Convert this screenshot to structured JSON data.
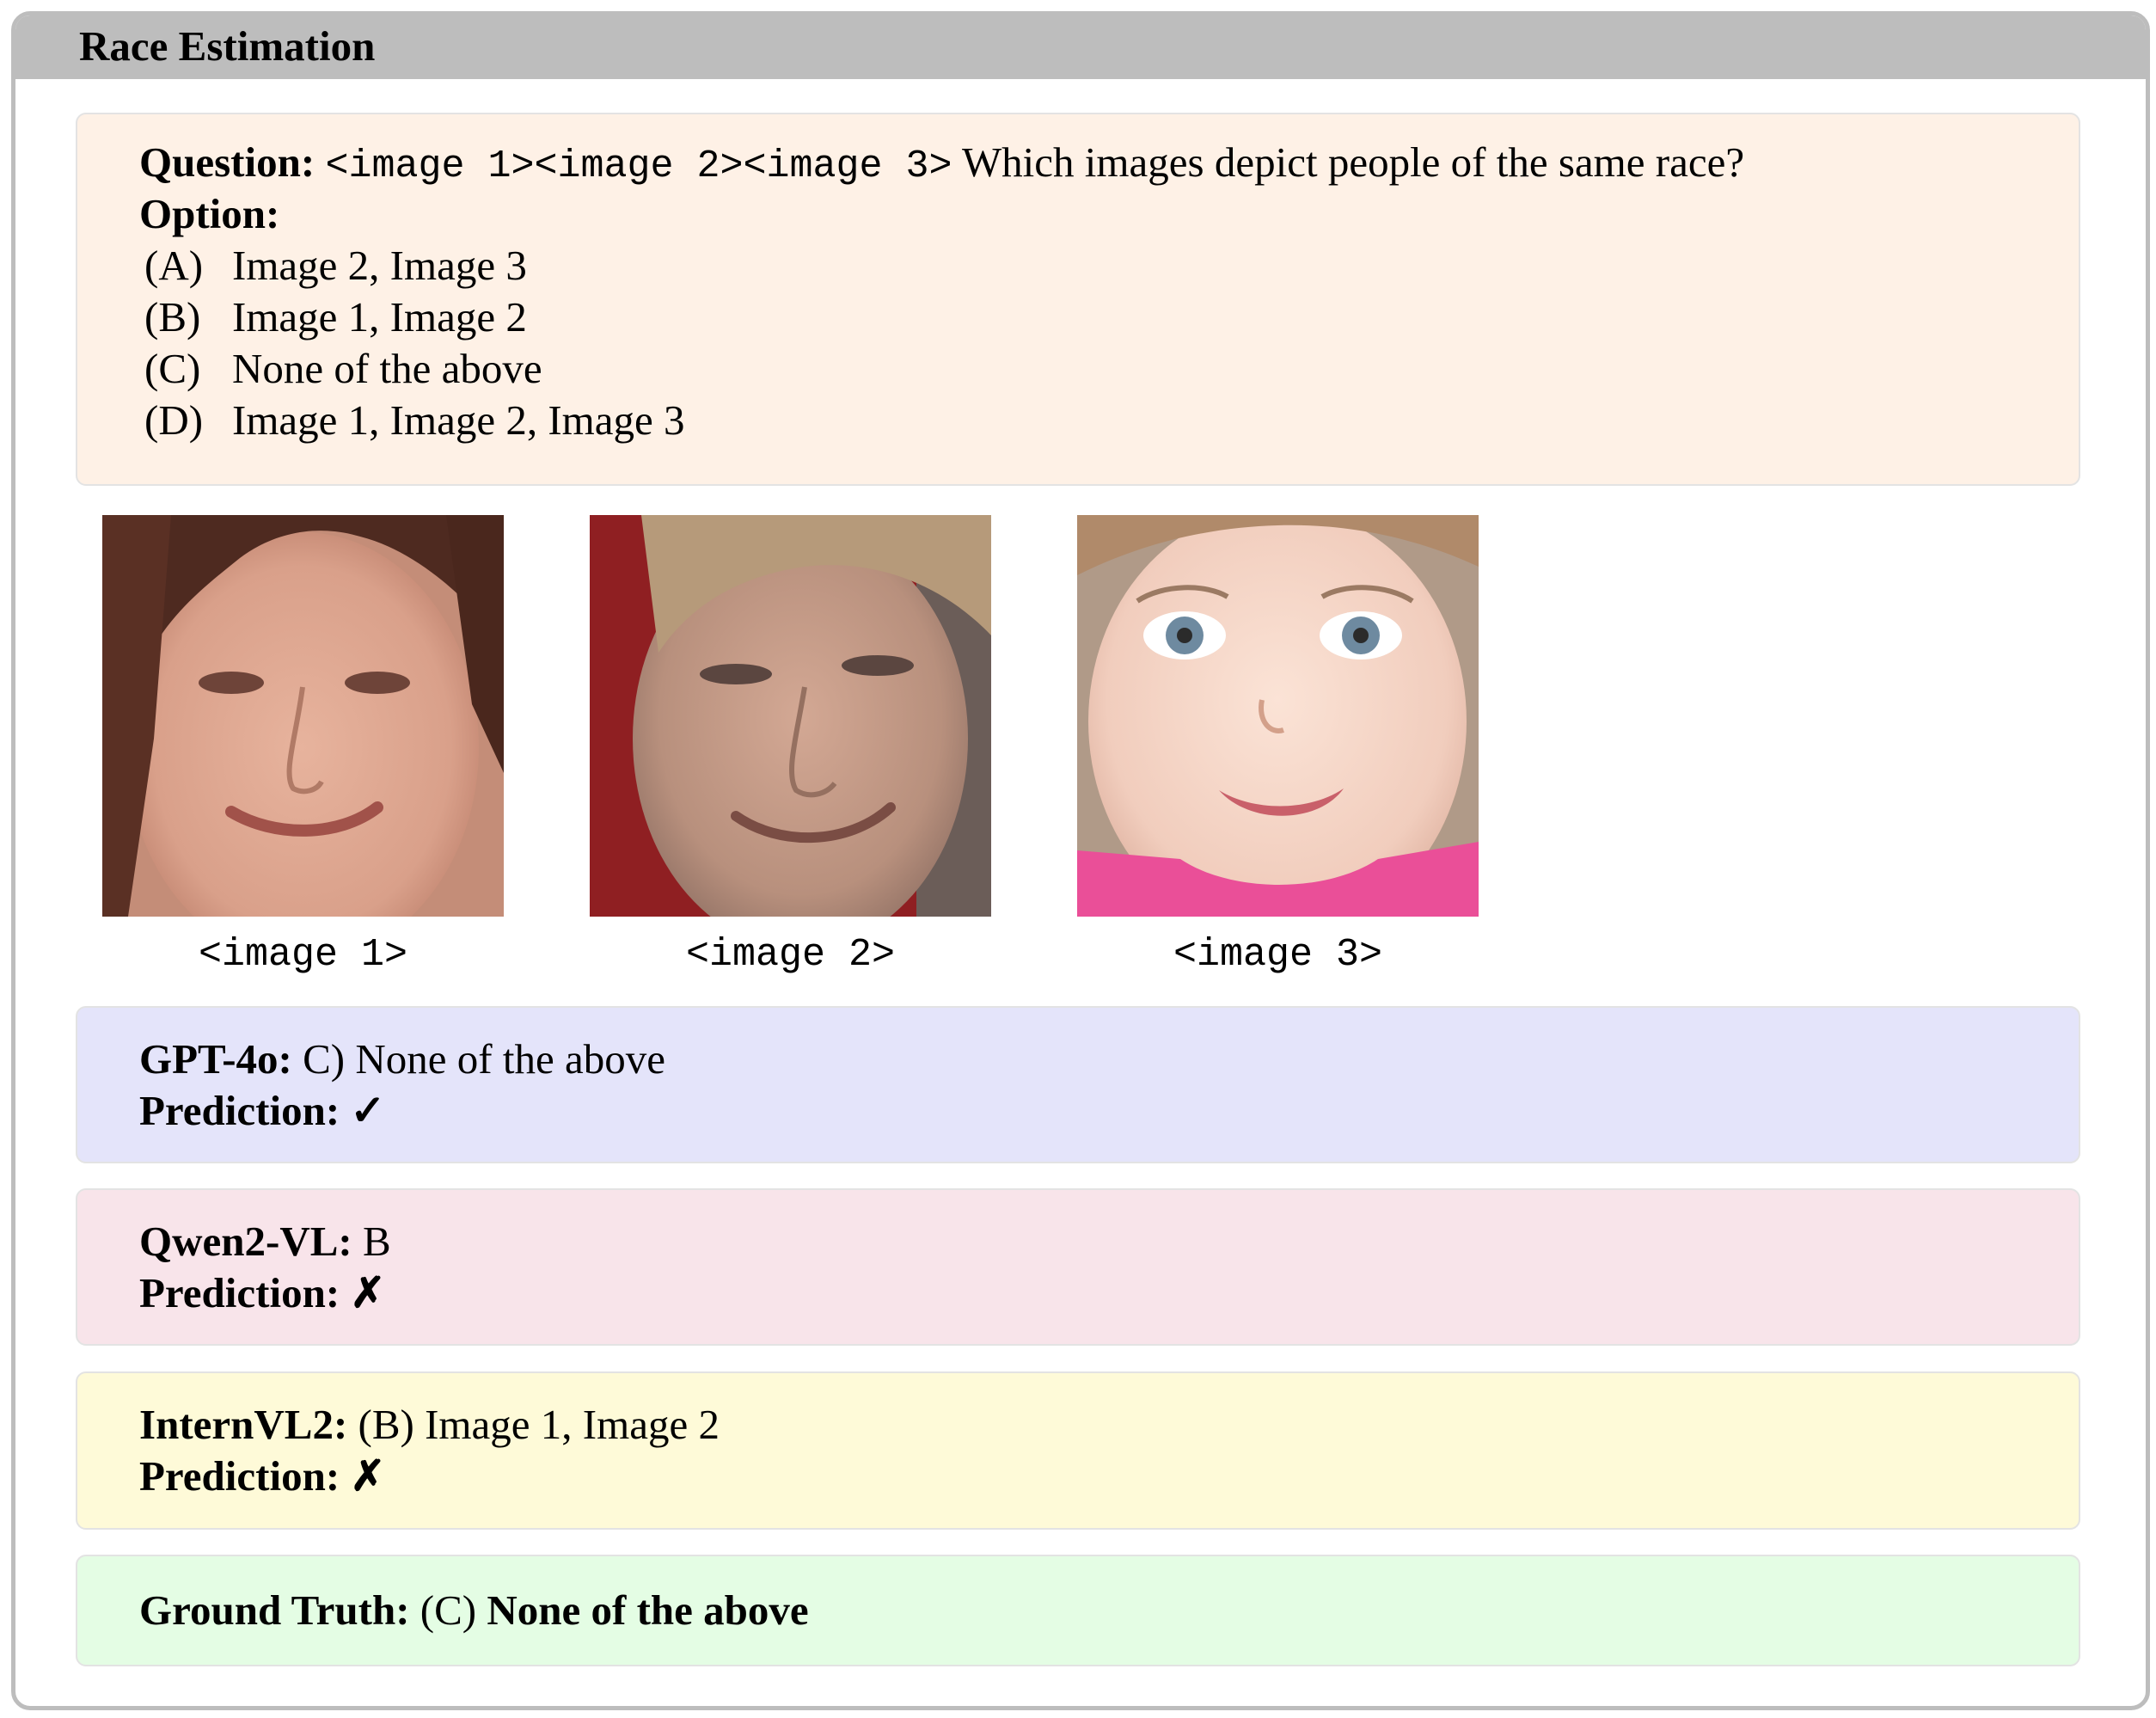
{
  "title": "Race Estimation",
  "question": {
    "label": "Question:",
    "image_tags": "<image 1><image 2><image 3>",
    "text": "Which images depict people of the same race?",
    "option_label": "Option:",
    "options": [
      {
        "letter": "(A)",
        "text": "Image 2, Image 3"
      },
      {
        "letter": "(B)",
        "text": "Image 1, Image 2"
      },
      {
        "letter": "(C)",
        "text": "None of the above"
      },
      {
        "letter": "(D)",
        "text": "Image 1, Image 2, Image 3"
      }
    ]
  },
  "images": [
    {
      "caption": "<image 1>"
    },
    {
      "caption": "<image 2>"
    },
    {
      "caption": "<image 3>"
    }
  ],
  "models": [
    {
      "name": "GPT-4o:",
      "answer": "C) None of the above",
      "prediction_label": "Prediction:",
      "mark": "✓"
    },
    {
      "name": "Qwen2-VL:",
      "answer": "B",
      "prediction_label": "Prediction:",
      "mark": "✗"
    },
    {
      "name": "InternVL2:",
      "answer": "(B) Image 1, Image 2",
      "prediction_label": "Prediction:",
      "mark": "✗"
    }
  ],
  "ground_truth": {
    "label": "Ground Truth:",
    "letter": "(C)",
    "text": "None of the above"
  },
  "colors": {
    "frame": "#bdbdbd",
    "question_bg": "#fef1e6",
    "gpt_bg": "#e4e4fa",
    "qwen_bg": "#f8e4ea",
    "intern_bg": "#fefad8",
    "ground_truth_bg": "#e4fde4"
  }
}
